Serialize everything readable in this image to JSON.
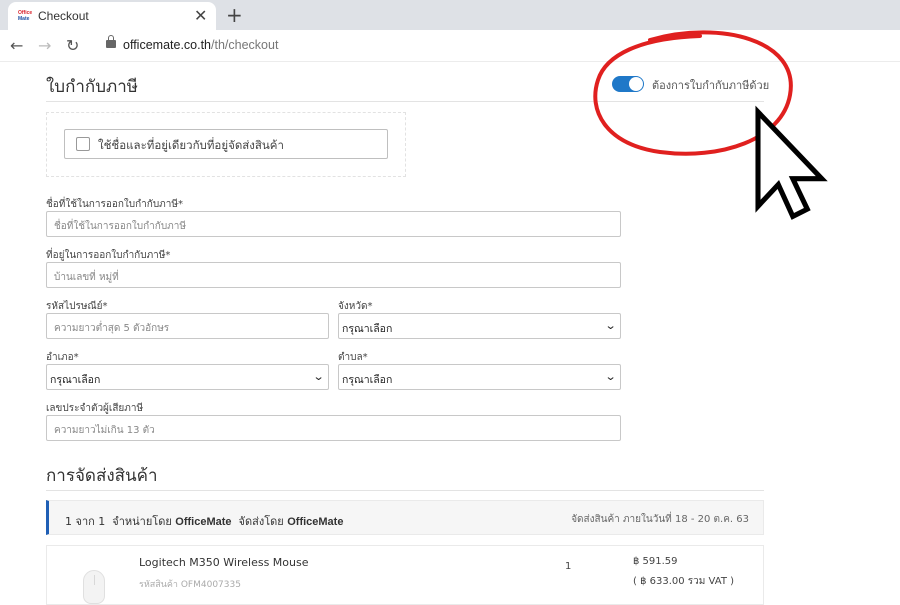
{
  "browser": {
    "tab_title": "Checkout",
    "favicon_top": "Office",
    "favicon_bottom": "Mate",
    "close_glyph": "✕",
    "new_tab_glyph": "+",
    "back_glyph": "←",
    "forward_glyph": "→",
    "reload_glyph": "↻",
    "url_host": "officemate.co.th",
    "url_path": "/th/checkout"
  },
  "invoice": {
    "title": "ใบกำกับภาษี",
    "toggle_label": "ต้องการใบกำกับภาษีด้วย",
    "toggle_on": true,
    "same_address_label": "ใช้ชื่อและที่อยู่เดียวกับที่อยู่จัดส่งสินค้า",
    "fields": {
      "name_label": "ชื่อที่ใช้ในการออกใบกำกับภาษี*",
      "name_placeholder": "ชื่อที่ใช้ในการออกใบกำกับภาษี",
      "address_label": "ที่อยู่ในการออกใบกำกับภาษี*",
      "address_placeholder": "บ้านเลขที่ หมู่ที่",
      "postcode_label": "รหัสไปรษณีย์*",
      "postcode_placeholder": "ความยาวต่ำสุด 5 ตัวอักษร",
      "province_label": "จังหวัด*",
      "province_value": "กรุณาเลือก",
      "district_label": "อำเภอ*",
      "district_value": "กรุณาเลือก",
      "subdistrict_label": "ตำบล*",
      "subdistrict_value": "กรุณาเลือก",
      "taxid_label": "เลขประจำตัวผู้เสียภาษี",
      "taxid_placeholder": "ความยาวไม่เกิน 13 ตัว"
    }
  },
  "shipping": {
    "title": "การจัดส่งสินค้า",
    "bar_prefix": "1 จาก 1",
    "bar_sold_by": "จำหน่ายโดย",
    "bar_seller": "OfficeMate",
    "bar_shipped_by": "จัดส่งโดย",
    "bar_shipper": "OfficeMate",
    "delivery_note": "จัดส่งสินค้า ภายในวันที่ 18 - 20 ต.ค. 63",
    "accent_color": "#1f5fb5",
    "product": {
      "name": "Logitech M350 Wireless Mouse",
      "sku": "รหัสสินค้า OFM4007335",
      "qty": "1",
      "price": "฿ 591.59",
      "price_vat": "( ฿ 633.00 รวม VAT )"
    }
  },
  "colors": {
    "toggle": "#1f78c8",
    "annotation_circle": "#e0201f"
  }
}
